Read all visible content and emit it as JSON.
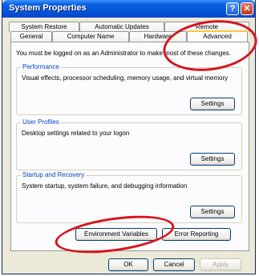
{
  "window": {
    "title": "System Properties",
    "help_glyph": "?",
    "close_glyph": "✕"
  },
  "tabs": {
    "row1": [
      "System Restore",
      "Automatic Updates",
      "Remote"
    ],
    "row2": [
      "General",
      "Computer Name",
      "Hardware",
      "Advanced"
    ],
    "active": "Advanced"
  },
  "advanced": {
    "admin_note": "You must be logged on as an Administrator to make most of these changes.",
    "performance": {
      "legend": "Performance",
      "description": "Visual effects, processor scheduling, memory usage, and virtual memory",
      "settings_label": "Settings"
    },
    "user_profiles": {
      "legend": "User Profiles",
      "description": "Desktop settings related to your logon",
      "settings_label": "Settings"
    },
    "startup_recovery": {
      "legend": "Startup and Recovery",
      "description": "System startup, system failure, and debugging information",
      "settings_label": "Settings"
    },
    "environment_variables_label": "Environment Variables",
    "error_reporting_label": "Error Reporting"
  },
  "footer": {
    "ok_label": "OK",
    "cancel_label": "Cancel",
    "apply_label": "Apply"
  },
  "highlight_color": "#d8141c"
}
